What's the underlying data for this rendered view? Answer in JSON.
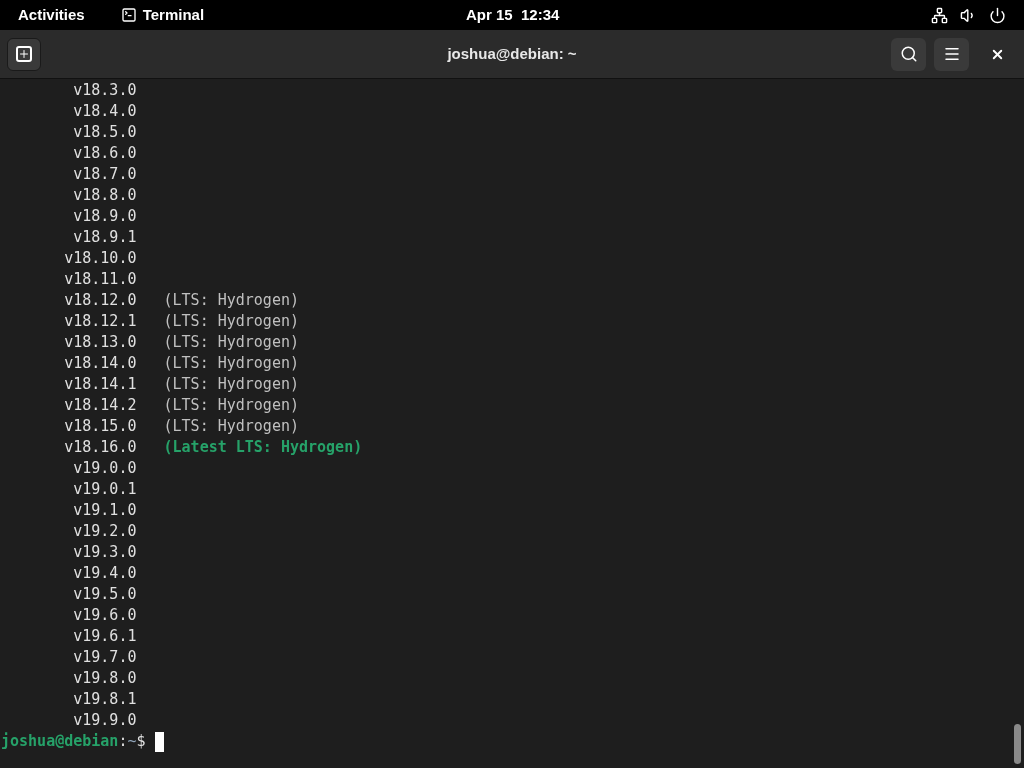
{
  "top_bar": {
    "activities": "Activities",
    "app_name": "Terminal",
    "clock": "Apr 15  12:34"
  },
  "window": {
    "title": "joshua@debian: ~"
  },
  "lines": [
    {
      "version": "v18.3.0",
      "kind": "plain"
    },
    {
      "version": "v18.4.0",
      "kind": "plain"
    },
    {
      "version": "v18.5.0",
      "kind": "plain"
    },
    {
      "version": "v18.6.0",
      "kind": "plain"
    },
    {
      "version": "v18.7.0",
      "kind": "plain"
    },
    {
      "version": "v18.8.0",
      "kind": "plain"
    },
    {
      "version": "v18.9.0",
      "kind": "plain"
    },
    {
      "version": "v18.9.1",
      "kind": "plain"
    },
    {
      "version": "v18.10.0",
      "kind": "plain"
    },
    {
      "version": "v18.11.0",
      "kind": "plain"
    },
    {
      "version": "v18.12.0",
      "kind": "lts",
      "note": "(LTS: Hydrogen)"
    },
    {
      "version": "v18.12.1",
      "kind": "lts",
      "note": "(LTS: Hydrogen)"
    },
    {
      "version": "v18.13.0",
      "kind": "lts",
      "note": "(LTS: Hydrogen)"
    },
    {
      "version": "v18.14.0",
      "kind": "lts",
      "note": "(LTS: Hydrogen)"
    },
    {
      "version": "v18.14.1",
      "kind": "lts",
      "note": "(LTS: Hydrogen)"
    },
    {
      "version": "v18.14.2",
      "kind": "lts",
      "note": "(LTS: Hydrogen)"
    },
    {
      "version": "v18.15.0",
      "kind": "lts",
      "note": "(LTS: Hydrogen)"
    },
    {
      "version": "v18.16.0",
      "kind": "latest",
      "note": "(Latest LTS: Hydrogen)"
    },
    {
      "version": "v19.0.0",
      "kind": "plain"
    },
    {
      "version": "v19.0.1",
      "kind": "plain"
    },
    {
      "version": "v19.1.0",
      "kind": "plain"
    },
    {
      "version": "v19.2.0",
      "kind": "plain"
    },
    {
      "version": "v19.3.0",
      "kind": "plain"
    },
    {
      "version": "v19.4.0",
      "kind": "plain"
    },
    {
      "version": "v19.5.0",
      "kind": "plain"
    },
    {
      "version": "v19.6.0",
      "kind": "plain"
    },
    {
      "version": "v19.6.1",
      "kind": "plain"
    },
    {
      "version": "v19.7.0",
      "kind": "plain"
    },
    {
      "version": "v19.8.0",
      "kind": "plain"
    },
    {
      "version": "v19.8.1",
      "kind": "plain"
    },
    {
      "version": "v19.9.0",
      "kind": "plain"
    }
  ],
  "prompt": {
    "user_host": "joshua@debian",
    "colon": ":",
    "path": "~",
    "symbol": "$"
  }
}
